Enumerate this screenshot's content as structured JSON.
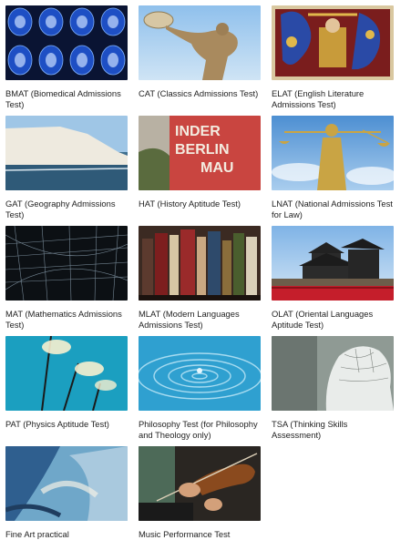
{
  "tests": [
    {
      "id": "bmat",
      "label": "BMAT (Biomedical Admissions Test)",
      "icon": "brain-scan-image"
    },
    {
      "id": "cat",
      "label": "CAT (Classics Admissions Test)",
      "icon": "discobolus-statue-image"
    },
    {
      "id": "elat",
      "label": "ELAT (English Literature Admissions Test)",
      "icon": "illuminated-manuscript-image"
    },
    {
      "id": "gat",
      "label": "GAT (Geography Admissions Test)",
      "icon": "white-cliffs-image"
    },
    {
      "id": "hat",
      "label": "HAT (History Aptitude Test)",
      "icon": "berlin-wall-graffiti-image"
    },
    {
      "id": "lnat",
      "label": "LNAT (National Admissions Test for Law)",
      "icon": "lady-justice-image"
    },
    {
      "id": "mat",
      "label": "MAT (Mathematics Admissions Test)",
      "icon": "wireframe-grid-image"
    },
    {
      "id": "mlat",
      "label": "MLAT (Modern Languages Admissions Test)",
      "icon": "books-shelf-image"
    },
    {
      "id": "olat",
      "label": "OLAT (Oriental Languages Aptitude Test)",
      "icon": "japanese-castle-image"
    },
    {
      "id": "pat",
      "label": "PAT (Physics Aptitude Test)",
      "icon": "light-bulbs-image"
    },
    {
      "id": "philosophy",
      "label": "Philosophy Test (for Philosophy and Theology only)",
      "icon": "water-ripple-image"
    },
    {
      "id": "tsa",
      "label": "TSA (Thinking Skills Assessment)",
      "icon": "phrenology-head-image"
    },
    {
      "id": "fineart",
      "label": "Fine Art practical",
      "icon": "abstract-painting-image"
    },
    {
      "id": "music",
      "label": "Music Performance Test",
      "icon": "violin-player-image"
    }
  ]
}
